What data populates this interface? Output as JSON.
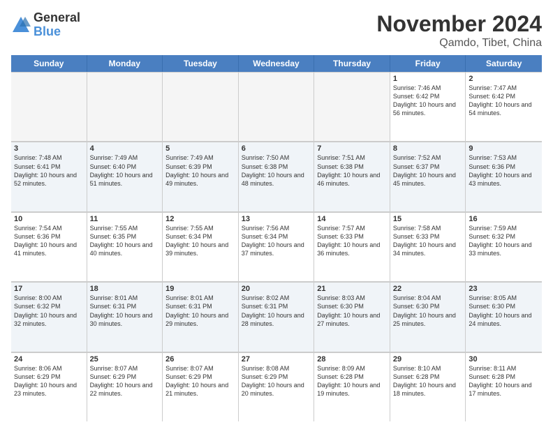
{
  "logo": {
    "general": "General",
    "blue": "Blue"
  },
  "title": "November 2024",
  "location": "Qamdo, Tibet, China",
  "days_of_week": [
    "Sunday",
    "Monday",
    "Tuesday",
    "Wednesday",
    "Thursday",
    "Friday",
    "Saturday"
  ],
  "weeks": [
    [
      {
        "day": "",
        "info": "",
        "empty": true
      },
      {
        "day": "",
        "info": "",
        "empty": true
      },
      {
        "day": "",
        "info": "",
        "empty": true
      },
      {
        "day": "",
        "info": "",
        "empty": true
      },
      {
        "day": "",
        "info": "",
        "empty": true
      },
      {
        "day": "1",
        "info": "Sunrise: 7:46 AM\nSunset: 6:42 PM\nDaylight: 10 hours and 56 minutes."
      },
      {
        "day": "2",
        "info": "Sunrise: 7:47 AM\nSunset: 6:42 PM\nDaylight: 10 hours and 54 minutes."
      }
    ],
    [
      {
        "day": "3",
        "info": "Sunrise: 7:48 AM\nSunset: 6:41 PM\nDaylight: 10 hours and 52 minutes."
      },
      {
        "day": "4",
        "info": "Sunrise: 7:49 AM\nSunset: 6:40 PM\nDaylight: 10 hours and 51 minutes."
      },
      {
        "day": "5",
        "info": "Sunrise: 7:49 AM\nSunset: 6:39 PM\nDaylight: 10 hours and 49 minutes."
      },
      {
        "day": "6",
        "info": "Sunrise: 7:50 AM\nSunset: 6:38 PM\nDaylight: 10 hours and 48 minutes."
      },
      {
        "day": "7",
        "info": "Sunrise: 7:51 AM\nSunset: 6:38 PM\nDaylight: 10 hours and 46 minutes."
      },
      {
        "day": "8",
        "info": "Sunrise: 7:52 AM\nSunset: 6:37 PM\nDaylight: 10 hours and 45 minutes."
      },
      {
        "day": "9",
        "info": "Sunrise: 7:53 AM\nSunset: 6:36 PM\nDaylight: 10 hours and 43 minutes."
      }
    ],
    [
      {
        "day": "10",
        "info": "Sunrise: 7:54 AM\nSunset: 6:36 PM\nDaylight: 10 hours and 41 minutes."
      },
      {
        "day": "11",
        "info": "Sunrise: 7:55 AM\nSunset: 6:35 PM\nDaylight: 10 hours and 40 minutes."
      },
      {
        "day": "12",
        "info": "Sunrise: 7:55 AM\nSunset: 6:34 PM\nDaylight: 10 hours and 39 minutes."
      },
      {
        "day": "13",
        "info": "Sunrise: 7:56 AM\nSunset: 6:34 PM\nDaylight: 10 hours and 37 minutes."
      },
      {
        "day": "14",
        "info": "Sunrise: 7:57 AM\nSunset: 6:33 PM\nDaylight: 10 hours and 36 minutes."
      },
      {
        "day": "15",
        "info": "Sunrise: 7:58 AM\nSunset: 6:33 PM\nDaylight: 10 hours and 34 minutes."
      },
      {
        "day": "16",
        "info": "Sunrise: 7:59 AM\nSunset: 6:32 PM\nDaylight: 10 hours and 33 minutes."
      }
    ],
    [
      {
        "day": "17",
        "info": "Sunrise: 8:00 AM\nSunset: 6:32 PM\nDaylight: 10 hours and 32 minutes."
      },
      {
        "day": "18",
        "info": "Sunrise: 8:01 AM\nSunset: 6:31 PM\nDaylight: 10 hours and 30 minutes."
      },
      {
        "day": "19",
        "info": "Sunrise: 8:01 AM\nSunset: 6:31 PM\nDaylight: 10 hours and 29 minutes."
      },
      {
        "day": "20",
        "info": "Sunrise: 8:02 AM\nSunset: 6:31 PM\nDaylight: 10 hours and 28 minutes."
      },
      {
        "day": "21",
        "info": "Sunrise: 8:03 AM\nSunset: 6:30 PM\nDaylight: 10 hours and 27 minutes."
      },
      {
        "day": "22",
        "info": "Sunrise: 8:04 AM\nSunset: 6:30 PM\nDaylight: 10 hours and 25 minutes."
      },
      {
        "day": "23",
        "info": "Sunrise: 8:05 AM\nSunset: 6:30 PM\nDaylight: 10 hours and 24 minutes."
      }
    ],
    [
      {
        "day": "24",
        "info": "Sunrise: 8:06 AM\nSunset: 6:29 PM\nDaylight: 10 hours and 23 minutes."
      },
      {
        "day": "25",
        "info": "Sunrise: 8:07 AM\nSunset: 6:29 PM\nDaylight: 10 hours and 22 minutes."
      },
      {
        "day": "26",
        "info": "Sunrise: 8:07 AM\nSunset: 6:29 PM\nDaylight: 10 hours and 21 minutes."
      },
      {
        "day": "27",
        "info": "Sunrise: 8:08 AM\nSunset: 6:29 PM\nDaylight: 10 hours and 20 minutes."
      },
      {
        "day": "28",
        "info": "Sunrise: 8:09 AM\nSunset: 6:28 PM\nDaylight: 10 hours and 19 minutes."
      },
      {
        "day": "29",
        "info": "Sunrise: 8:10 AM\nSunset: 6:28 PM\nDaylight: 10 hours and 18 minutes."
      },
      {
        "day": "30",
        "info": "Sunrise: 8:11 AM\nSunset: 6:28 PM\nDaylight: 10 hours and 17 minutes."
      }
    ]
  ]
}
